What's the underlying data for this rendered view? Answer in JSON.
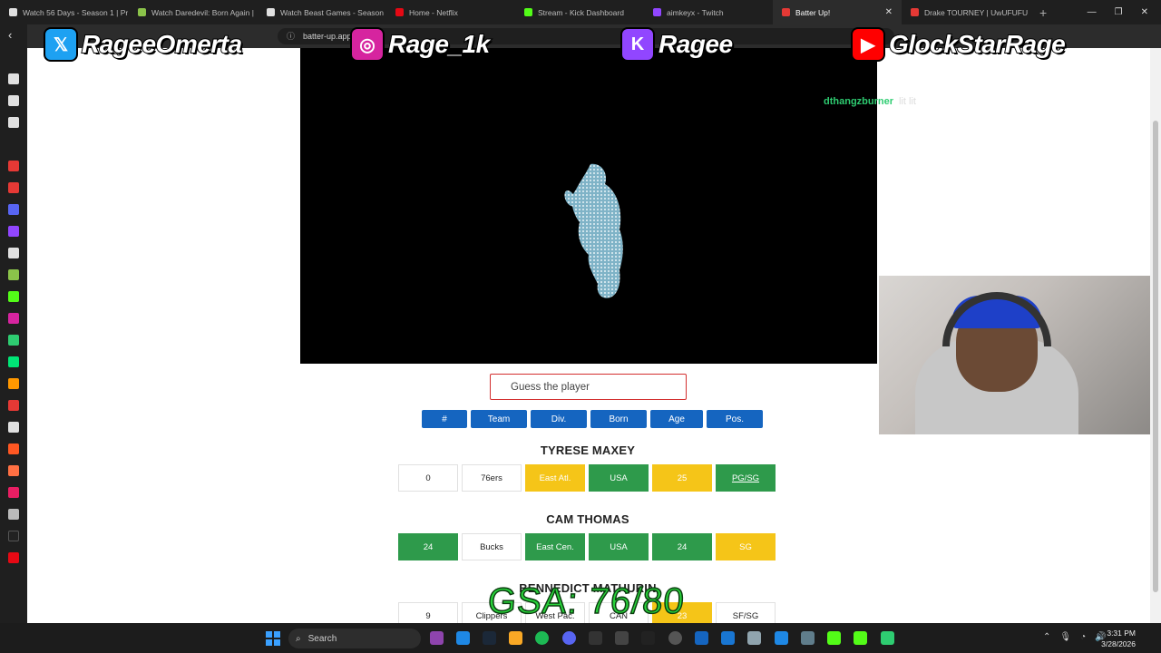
{
  "browser": {
    "tabs": [
      {
        "title": "Watch 56 Days - Season 1 | Pr",
        "color": "#e0e0e0",
        "active": false
      },
      {
        "title": "Watch Daredevil: Born Again |",
        "color": "#8bc34a",
        "active": false
      },
      {
        "title": "Watch Beast Games - Season",
        "color": "#e0e0e0",
        "active": false
      },
      {
        "title": "Home - Netflix",
        "color": "#e50914",
        "active": false
      },
      {
        "title": "Stream - Kick Dashboard",
        "color": "#53fc18",
        "active": false
      },
      {
        "title": "aimkeyx - Twitch",
        "color": "#9146ff",
        "active": false
      },
      {
        "title": "Batter Up!",
        "color": "#e53935",
        "active": true
      },
      {
        "title": "Drake TOURNEY | UwUFUFU",
        "color": "#e53935",
        "active": false
      }
    ],
    "tab_close": "✕",
    "new_tab": "+",
    "window_controls": [
      "—",
      "❐",
      "✕"
    ],
    "url": "batter-up.app/jump"
  },
  "overlay": {
    "socials": [
      {
        "icon": "x-icon",
        "glyph": "𝕏",
        "color": "#1da1f2",
        "handle": "RageeOmerta"
      },
      {
        "icon": "instagram-icon",
        "glyph": "◎",
        "color": "#d6249f",
        "handle": "Rage_1k"
      },
      {
        "icon": "twitch-kick-icon",
        "glyph": "K",
        "color": "#9146ff",
        "handle": "Ragee"
      },
      {
        "icon": "youtube-tiktok-icon",
        "glyph": "▶",
        "color": "#ff0000",
        "handle": "GlockStarRage"
      }
    ],
    "chat_user": "dthangzburner",
    "chat_msg": "lit lit",
    "gsa": "GSA: 76/80"
  },
  "game": {
    "guess_placeholder": "Guess the player",
    "headers": [
      "#",
      "Team",
      "Div.",
      "Born",
      "Age",
      "Pos."
    ],
    "guesses": [
      {
        "name": "TYRESE MAXEY",
        "cells": [
          {
            "value": "0",
            "status": "none"
          },
          {
            "value": "76ers",
            "status": "none"
          },
          {
            "value": "East Atl.",
            "status": "yellow"
          },
          {
            "value": "USA",
            "status": "green"
          },
          {
            "value": "25",
            "status": "yellow"
          },
          {
            "value": "PG/SG",
            "status": "green"
          }
        ]
      },
      {
        "name": "CAM THOMAS",
        "cells": [
          {
            "value": "24",
            "status": "green"
          },
          {
            "value": "Bucks",
            "status": "none"
          },
          {
            "value": "East Cen.",
            "status": "green"
          },
          {
            "value": "USA",
            "status": "green"
          },
          {
            "value": "24",
            "status": "green"
          },
          {
            "value": "SG",
            "status": "yellow"
          }
        ]
      },
      {
        "name": "BENNEDICT MATHURIN",
        "cells": [
          {
            "value": "9",
            "status": "none"
          },
          {
            "value": "Clippers",
            "status": "none"
          },
          {
            "value": "West Pac.",
            "status": "none"
          },
          {
            "value": "CAN",
            "status": "none"
          },
          {
            "value": "23",
            "status": "yellow"
          },
          {
            "value": "SF/SG",
            "status": "none"
          }
        ]
      }
    ]
  },
  "taskbar": {
    "search_label": "Search",
    "time": "3:31 PM",
    "date": "3/28/2026"
  }
}
